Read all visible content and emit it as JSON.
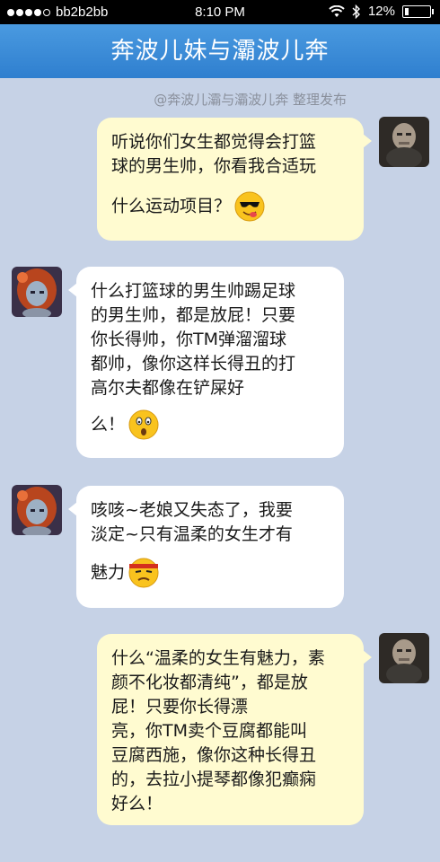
{
  "status_bar": {
    "carrier": "bb2b2bb",
    "time": "8:10 PM",
    "battery": "12%"
  },
  "header": {
    "title": "奔波儿妹与灞波儿奔"
  },
  "attribution": "@奔波儿灞与灞波儿奔 整理发布",
  "messages": [
    {
      "lines": [
        "听说你们女生都觉得会打篮",
        "球的男生帅，你看我合适玩",
        "什么运动项目？"
      ],
      "emoji": "sunglasses-tongue-emoji"
    },
    {
      "lines": [
        "什么打篮球的男生帅踢足球",
        "的男生帅，都是放屁！只要",
        "你长得帅，你TM弹溜溜球",
        "都帅，像你这样长得丑的打",
        "高尔夫都像在铲屎好",
        "么！"
      ],
      "emoji": "shocked-face-emoji"
    },
    {
      "lines": [
        "咳咳~老娘又失态了，我要",
        "淡定~只有温柔的女生才有",
        "魅力"
      ],
      "emoji": "headband-determined-emoji"
    },
    {
      "lines": [
        "什么“温柔的女生有魅力，素",
        "颜不化妆都清纯”，都是放",
        "屁！只要你长得漂",
        "亮，你TM卖个豆腐都能叫",
        "豆腐西施，像你这种长得丑",
        "的，去拉小提琴都像犯癫痫",
        "好么！"
      ]
    }
  ],
  "colors": {
    "background": "#c6d2e6",
    "title_bar": "#3d8ddb",
    "outgoing_bubble": "#fffbd0",
    "incoming_bubble": "#ffffff"
  }
}
